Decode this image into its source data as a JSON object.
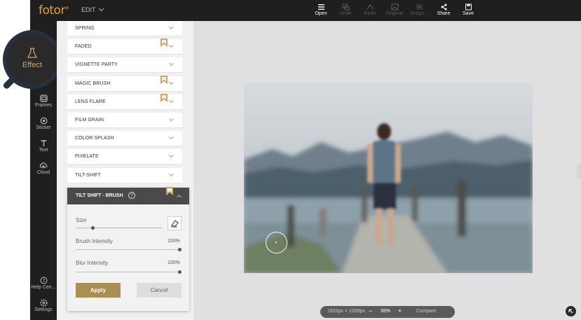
{
  "app": {
    "logo": "fotor",
    "logo_mark": "®",
    "menu_label": "EDIT"
  },
  "toolbar": {
    "open": "Open",
    "undo": "Undo",
    "redo": "Redo",
    "original": "Original",
    "snapshot": "Snaps...",
    "share": "Share",
    "save": "Save"
  },
  "rail": {
    "effect": "Effect",
    "frames": "Frames",
    "sticker": "Sticker",
    "text": "Text",
    "cloud": "Cloud",
    "help": "Help Cen...",
    "settings": "Settings"
  },
  "effects": [
    {
      "label": "SPRING",
      "premium": false
    },
    {
      "label": "FADED",
      "premium": true
    },
    {
      "label": "VIGNETTE PARTY",
      "premium": false
    },
    {
      "label": "MAGIC BRUSH",
      "premium": true
    },
    {
      "label": "LENS FLARE",
      "premium": true
    },
    {
      "label": "FILM GRAIN",
      "premium": false
    },
    {
      "label": "COLOR SPLASH",
      "premium": false
    },
    {
      "label": "PIXELATE",
      "premium": false
    },
    {
      "label": "TILT-SHIFT",
      "premium": false
    }
  ],
  "expanded": {
    "title": "TILT SHIFT - BRUSH",
    "help_glyph": "?",
    "size_label": "Size",
    "size_level": 0.2,
    "brush_label": "Brush Intensity",
    "brush_value": "100%",
    "blur_label": "Blur Intensity",
    "blur_value": "100%",
    "apply": "Apply",
    "cancel": "Cancel"
  },
  "status": {
    "dimensions": "1920px × 1269px",
    "minus": "−",
    "zoom": "39%",
    "plus": "+",
    "compare": "Compare"
  },
  "colors": {
    "accent": "#a98f54",
    "dark_bar": "#1f1f1f",
    "logo": "#e4a33a"
  }
}
